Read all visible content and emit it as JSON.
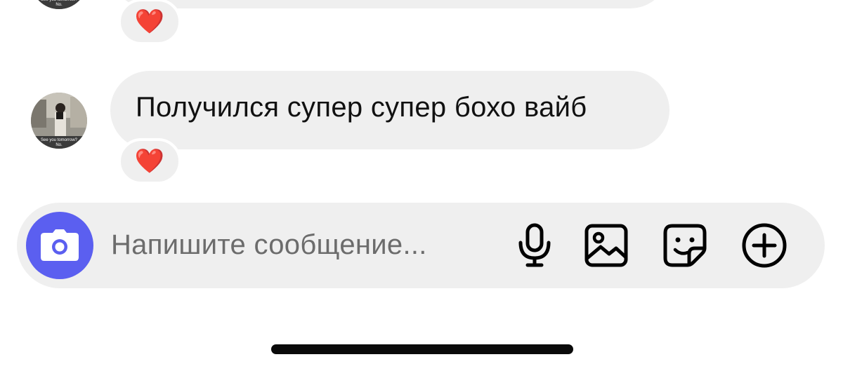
{
  "messages": [
    {
      "text": "",
      "reaction": "❤️"
    },
    {
      "text": "Получился супер супер бохо вайб",
      "reaction": "❤️"
    }
  ],
  "avatar": {
    "caption_line1": "See you tomorrow?",
    "caption_line2": "No."
  },
  "composer": {
    "placeholder": "Напишите сообщение..."
  },
  "icons": {
    "camera": "camera-icon",
    "mic": "microphone-icon",
    "gallery": "image-gallery-icon",
    "sticker": "sticker-icon",
    "more": "plus-circle-icon"
  },
  "colors": {
    "accent": "#5b5ff0",
    "bubble": "#efefef",
    "heart": "#ee1d2e"
  }
}
